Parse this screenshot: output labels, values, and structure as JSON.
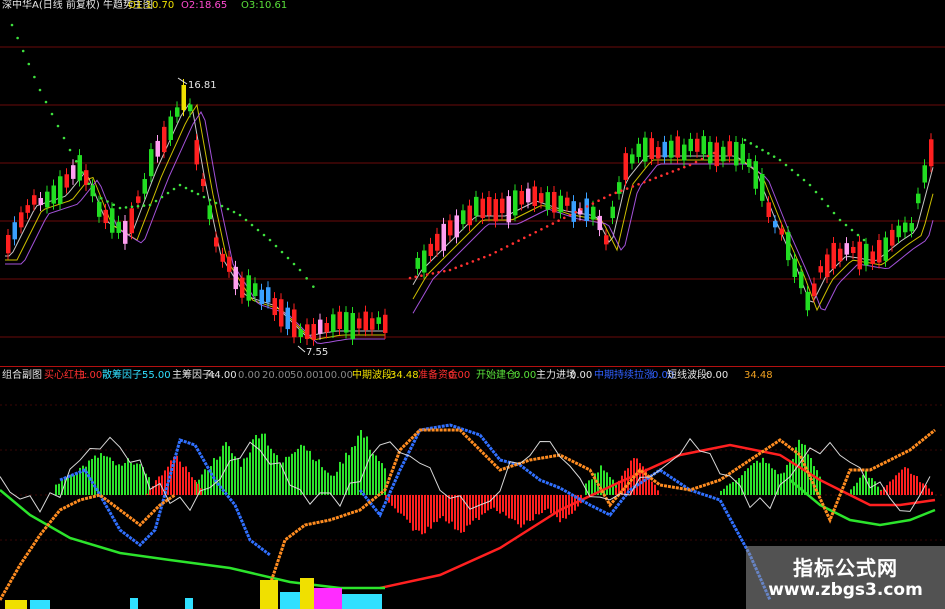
{
  "header": {
    "title": "深中华A(日线 前复权) 牛趋势主图",
    "o_text": "O1:10.70",
    "h_text": "O2:18.65",
    "l_text": "O3:10.61"
  },
  "price_chart": {
    "high_label": "16.81",
    "low_label": "7.55"
  },
  "indicator_header": [
    {
      "text": "组合副图",
      "color": "#e6e6e6"
    },
    {
      "text": "买心红柱:",
      "color": "#ff3030"
    },
    {
      "text": "1.00",
      "color": "#ff3030"
    },
    {
      "text": "散筹因子:",
      "color": "#30e0ff"
    },
    {
      "text": "55.00",
      "color": "#30e0ff"
    },
    {
      "text": "主筹因子:",
      "color": "#e6e6e6"
    },
    {
      "text": "44.00",
      "color": "#e6e6e6"
    },
    {
      "text": "0.00",
      "color": "#888888"
    },
    {
      "text": "20.00",
      "color": "#888888"
    },
    {
      "text": "50.00",
      "color": "#888888"
    },
    {
      "text": "100.00",
      "color": "#888888"
    },
    {
      "text": "中期波段:",
      "color": "#f0e000"
    },
    {
      "text": "34.48",
      "color": "#f0e000"
    },
    {
      "text": "准备资金",
      "color": "#ff3030"
    },
    {
      "text": "0.00",
      "color": "#ff3030"
    },
    {
      "text": "开始建仓:",
      "color": "#59e03a"
    },
    {
      "text": "0.00",
      "color": "#59e03a"
    },
    {
      "text": "主力进场",
      "color": "#e6e6e6"
    },
    {
      "text": "0.00",
      "color": "#e6e6e6"
    },
    {
      "text": "中期持续拉涨",
      "color": "#3060ff"
    },
    {
      "text": "0.00",
      "color": "#3060ff"
    },
    {
      "text": "短线波段:",
      "color": "#e6e6e6"
    },
    {
      "text": "0.00",
      "color": "#e6e6e6"
    },
    {
      "text": "34.48",
      "color": "#f0a020"
    }
  ],
  "watermark": {
    "main": "指标公式网",
    "sub": "www.zbgs3.com"
  },
  "colors": {
    "up": "#ff2020",
    "down": "#22dd22",
    "grid": "#6a0a0a",
    "divider": "#b41010",
    "stop_dots": "#3ee03e"
  }
}
